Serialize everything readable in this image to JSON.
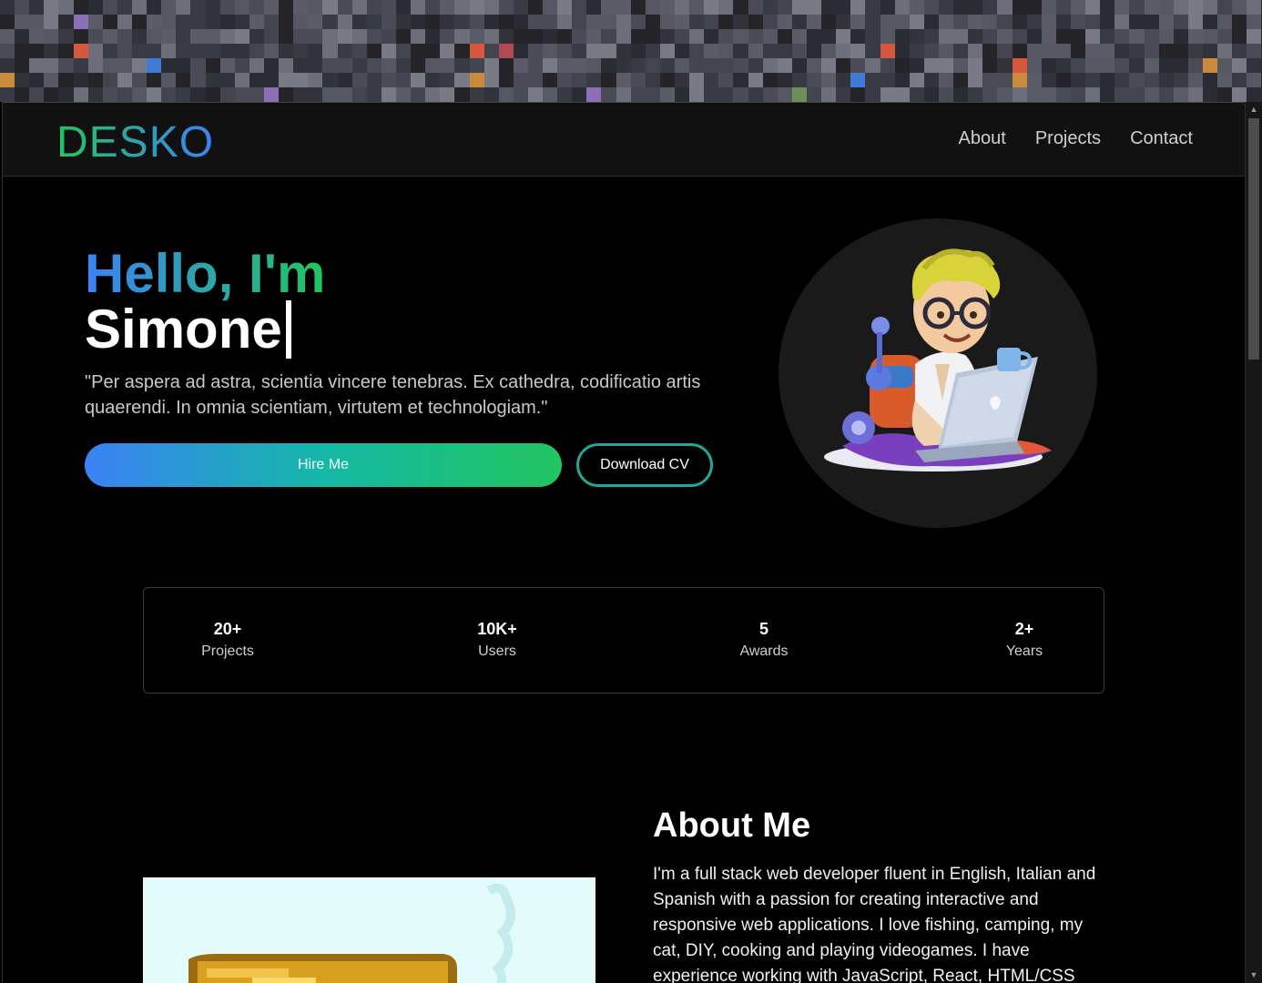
{
  "nav": {
    "logo": "DESKO",
    "links": [
      "About",
      "Projects",
      "Contact"
    ]
  },
  "hero": {
    "greeting": "Hello, I'm",
    "name": "Simone",
    "quote": "\"Per aspera ad astra, scientia vincere tenebras. Ex cathedra, codificatio artis quaerendi. In omnia scientiam, virtutem et technologiam.\"",
    "hire_label": "Hire Me",
    "cv_label": "Download CV"
  },
  "stats": [
    {
      "value": "20+",
      "label": "Projects"
    },
    {
      "value": "10K+",
      "label": "Users"
    },
    {
      "value": "5",
      "label": "Awards"
    },
    {
      "value": "2+",
      "label": "Years"
    }
  ],
  "about": {
    "title": "About Me",
    "text": "I'm a full stack web developer fluent in English, Italian and Spanish with a passion for creating interactive and responsive web applications. I love fishing, camping, my cat, DIY, cooking and playing videogames. I have experience working with JavaScript, React, HTML/CSS"
  },
  "colors": {
    "accent_green": "#22c55e",
    "accent_blue": "#3b82f6",
    "background": "#000000"
  },
  "icons": {
    "avatar": "developer-avatar-illustration",
    "about_image": "laptop-illustration"
  }
}
